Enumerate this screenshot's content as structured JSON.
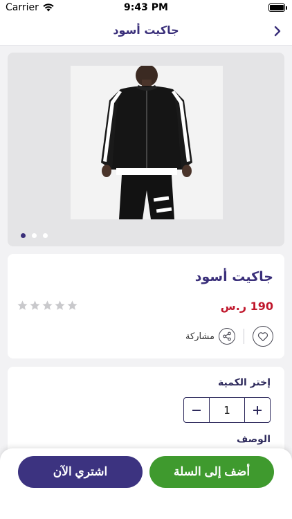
{
  "status_bar": {
    "carrier": "Carrier",
    "time": "9:43 PM"
  },
  "nav": {
    "title": "جاكيت أسود"
  },
  "gallery": {
    "dots": 3,
    "active_index": 0
  },
  "product": {
    "title": "جاكيت أسود",
    "price": "190 ر.س",
    "rating": 0,
    "rating_max": 5,
    "share_label": "مشاركة"
  },
  "quantity": {
    "label": "إختر الكمية",
    "value": "1"
  },
  "description": {
    "label": "الوصف"
  },
  "buttons": {
    "buy_now": "اشتري الآن",
    "add_to_cart": "أضف إلى السلة"
  },
  "colors": {
    "primary": "#3c3380",
    "accent_green": "#3f9a2e",
    "price_red": "#c0172c"
  }
}
